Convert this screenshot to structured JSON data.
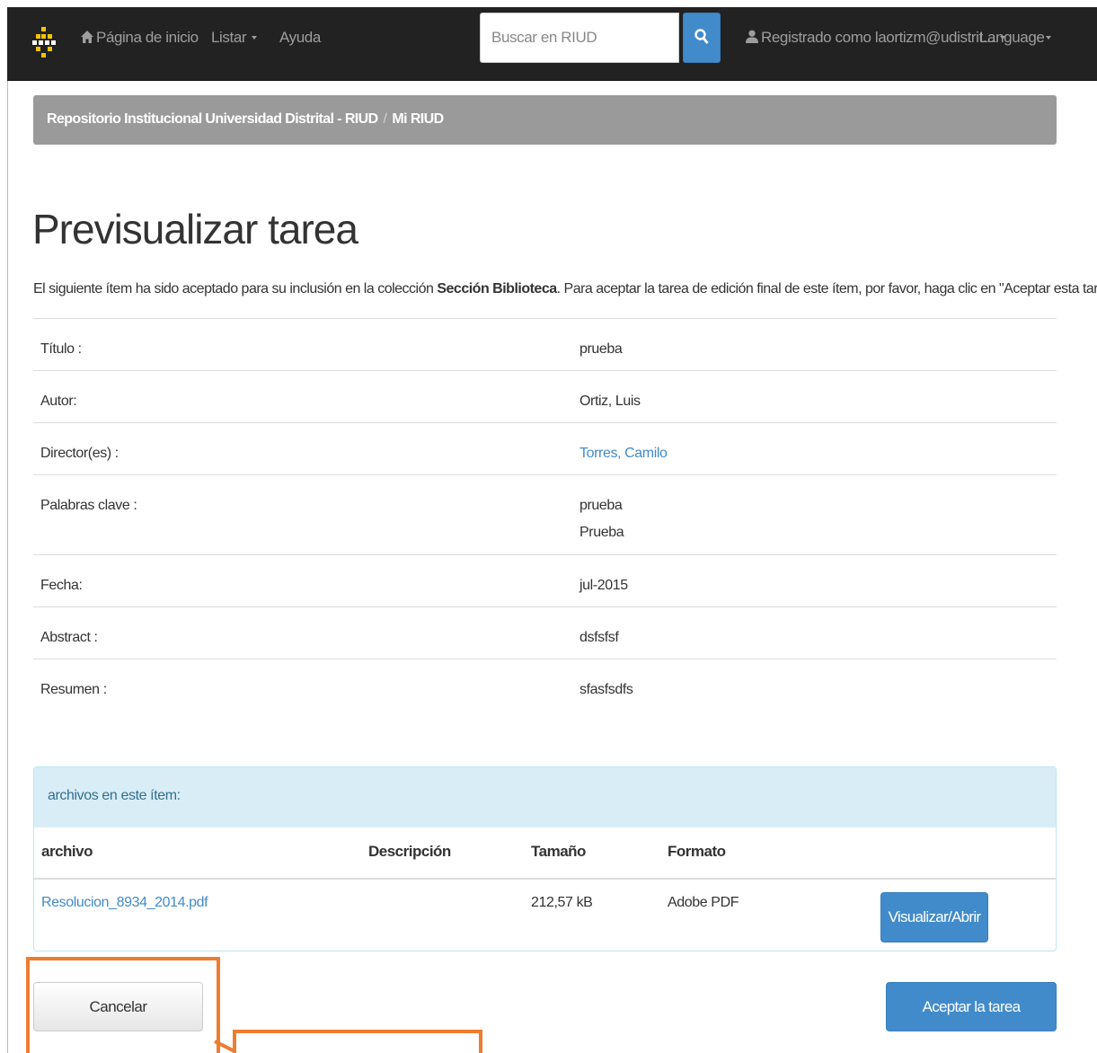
{
  "navbar": {
    "logo_icon": "riud-dots-logo-icon",
    "home_icon": "home-icon",
    "home_label": "Página de inicio",
    "list_label": "Listar",
    "help_label": "Ayuda",
    "search_placeholder": "Buscar en RIUD",
    "search_icon": "search-icon",
    "user_icon": "user-icon",
    "user_label": "Registrado como laortizm@udistrit...",
    "language_label": "Language"
  },
  "breadcrumb": {
    "root": "Repositorio Institucional Universidad Distrital - RIUD",
    "current": "Mi RIUD"
  },
  "page": {
    "title": "Previsualizar tarea",
    "intro_before": "El siguiente ítem ha sido aceptado para su inclusión en la colección ",
    "intro_collection": "Sección Biblioteca",
    "intro_after": ". Para aceptar la tarea de edición final de este ítem, por favor, haga clic en \"Aceptar esta tarea\"."
  },
  "metadata": [
    {
      "label": "Título :",
      "values": [
        "prueba"
      ]
    },
    {
      "label": "Autor:",
      "values": [
        "Ortiz, Luis"
      ]
    },
    {
      "label": "Director(es) :",
      "values": [
        "Torres, Camilo"
      ],
      "link": true
    },
    {
      "label": "Palabras clave :",
      "values": [
        "prueba",
        "Prueba"
      ]
    },
    {
      "label": "Fecha:",
      "values": [
        "jul-2015"
      ]
    },
    {
      "label": "Abstract :",
      "values": [
        "dsfsfsf"
      ]
    },
    {
      "label": "Resumen :",
      "values": [
        "sfasfsdfs"
      ]
    }
  ],
  "files": {
    "heading": "archivos en este ítem:",
    "columns": [
      "archivo",
      "Descripción",
      "Tamaño",
      "Formato"
    ],
    "rows": [
      {
        "file": "Resolucion_8934_2014.pdf",
        "description": "",
        "size": "212,57 kB",
        "format": "Adobe PDF",
        "action": "Visualizar/Abrir"
      }
    ]
  },
  "actions": {
    "cancel_label": "Cancelar",
    "accept_label": "Aceptar la tarea"
  },
  "colors": {
    "navbar": "#222222",
    "primary": "#428bca",
    "breadcrumb": "#9a9a9a",
    "panel_heading": "#d9edf7",
    "annotation": "#ed7d31"
  }
}
